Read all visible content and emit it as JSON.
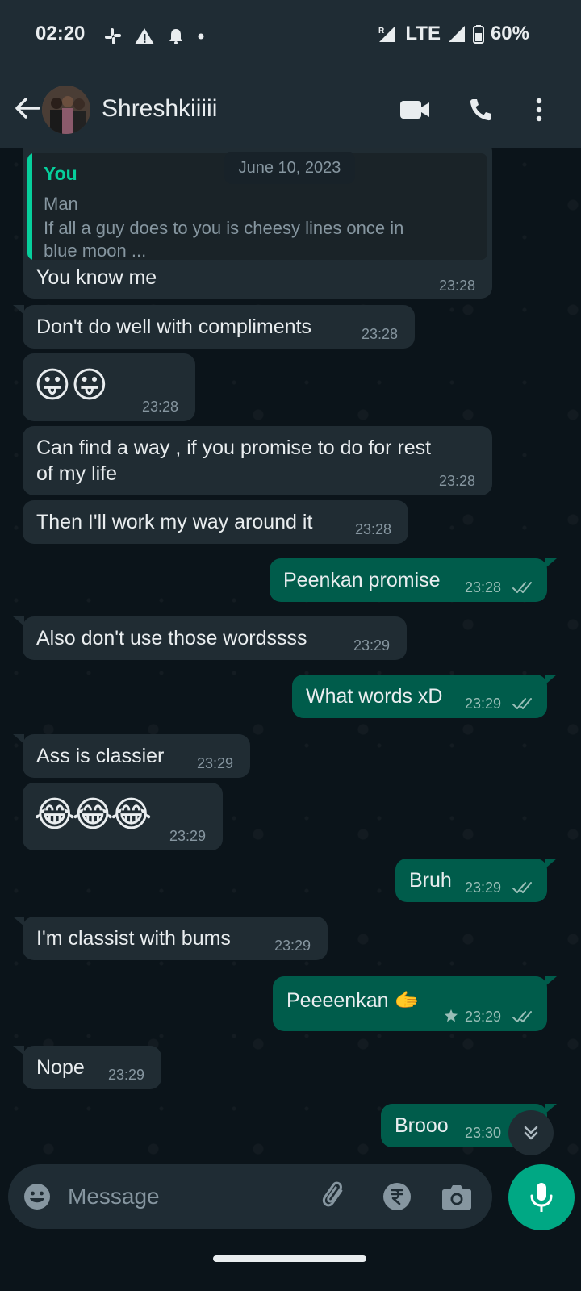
{
  "status_bar": {
    "time": "02:20",
    "network": "LTE",
    "battery": "60%",
    "roaming": "R"
  },
  "header": {
    "contact_name": "Shreshkiiiii"
  },
  "chat": {
    "date_chip": "June 10, 2023",
    "quoted": {
      "author": "You",
      "lines": [
        "Man",
        "If all a guy does to you is cheesy lines once in",
        "blue moon ..."
      ]
    },
    "messages": [
      {
        "dir": "in",
        "text": "You know me",
        "time": "23:28"
      },
      {
        "dir": "in",
        "text": "Don't do well with compliments",
        "time": "23:28"
      },
      {
        "dir": "in",
        "text": "😛😛",
        "time": "23:28"
      },
      {
        "dir": "in",
        "text_lines": [
          "Can find a way , if you promise to do for rest",
          "of my life"
        ],
        "time": "23:28"
      },
      {
        "dir": "in",
        "text": "Then I'll work my way around it",
        "time": "23:28"
      },
      {
        "dir": "out",
        "text": "Peenkan promise",
        "time": "23:28"
      },
      {
        "dir": "in",
        "text": "Also don't use those wordssss",
        "time": "23:29"
      },
      {
        "dir": "out",
        "text": "What words xD",
        "time": "23:29"
      },
      {
        "dir": "in",
        "text": "Ass is classier",
        "time": "23:29"
      },
      {
        "dir": "in",
        "text": "😂😂😂",
        "time": "23:29"
      },
      {
        "dir": "out",
        "text": "Bruh",
        "time": "23:29"
      },
      {
        "dir": "in",
        "text": "I'm classist with bums",
        "time": "23:29"
      },
      {
        "dir": "out",
        "text": "Peeeenkan 🫱",
        "time": "23:29",
        "starred": true
      },
      {
        "dir": "in",
        "text": "Nope",
        "time": "23:29"
      },
      {
        "dir": "out",
        "text": "Brooo",
        "time": "23:30"
      }
    ]
  },
  "input": {
    "placeholder": "Message"
  },
  "icons": {
    "status": [
      "slack-icon",
      "warning-icon",
      "bell-snooze-icon",
      "dot-icon"
    ],
    "header": [
      "back-arrow-icon",
      "video-call-icon",
      "phone-icon",
      "more-vert-icon"
    ],
    "input": [
      "emoji-icon",
      "attach-icon",
      "rupee-payment-icon",
      "camera-icon",
      "mic-icon"
    ]
  },
  "colors": {
    "incoming": "#202c33",
    "outgoing": "#005c4b",
    "accent": "#00a884",
    "background": "#0b141a"
  }
}
